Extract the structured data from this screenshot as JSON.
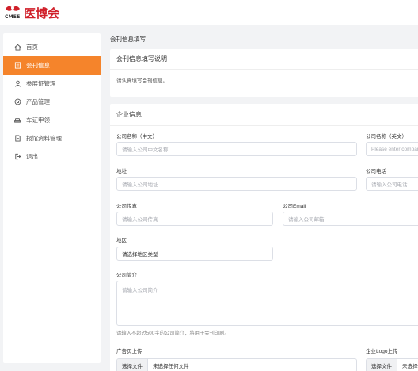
{
  "header": {
    "logo_small": "CMEE",
    "logo_main": "医博会"
  },
  "sidebar": {
    "items": [
      {
        "label": "首页",
        "icon": "home-icon"
      },
      {
        "label": "会刊信息",
        "icon": "document-icon"
      },
      {
        "label": "参展证管理",
        "icon": "badge-icon"
      },
      {
        "label": "产品管理",
        "icon": "product-icon"
      },
      {
        "label": "车证申领",
        "icon": "car-icon"
      },
      {
        "label": "报馆资料管理",
        "icon": "file-icon"
      },
      {
        "label": "退出",
        "icon": "logout-icon"
      }
    ],
    "active_index": 1
  },
  "main": {
    "page_title": "会刊信息填写",
    "notice_card": {
      "title": "会刊信息填写说明",
      "text": "请认真填写会刊信息。"
    },
    "form_card": {
      "title": "企业信息",
      "fields": {
        "name_cn": {
          "label": "公司名称（中文）",
          "placeholder": "请输入公司中文名称"
        },
        "name_en": {
          "label": "公司名称（英文）",
          "placeholder": "Please enter company name"
        },
        "address": {
          "label": "地址",
          "placeholder": "请输入公司地址"
        },
        "phone": {
          "label": "公司电话",
          "placeholder": "请输入公司电话"
        },
        "fax": {
          "label": "公司传真",
          "placeholder": "请输入公司传真"
        },
        "email": {
          "label": "公司Email",
          "placeholder": "请输入公司邮箱"
        },
        "region": {
          "label": "地区",
          "value": "请选择地区类型"
        },
        "intro": {
          "label": "公司简介",
          "placeholder": "请输入公司简介",
          "hint": "请输入不超过500字的公司简介，将用于会刊印刷。"
        },
        "ad_upload": {
          "label": "广告页上传",
          "button": "选择文件",
          "file": "未选择任何文件"
        },
        "logo_upload": {
          "label": "企业Logo上传",
          "button": "选择文件",
          "file": "未选择任何文件"
        }
      }
    }
  },
  "colors": {
    "accent": "#f5842b",
    "brand_red": "#d0202a"
  }
}
